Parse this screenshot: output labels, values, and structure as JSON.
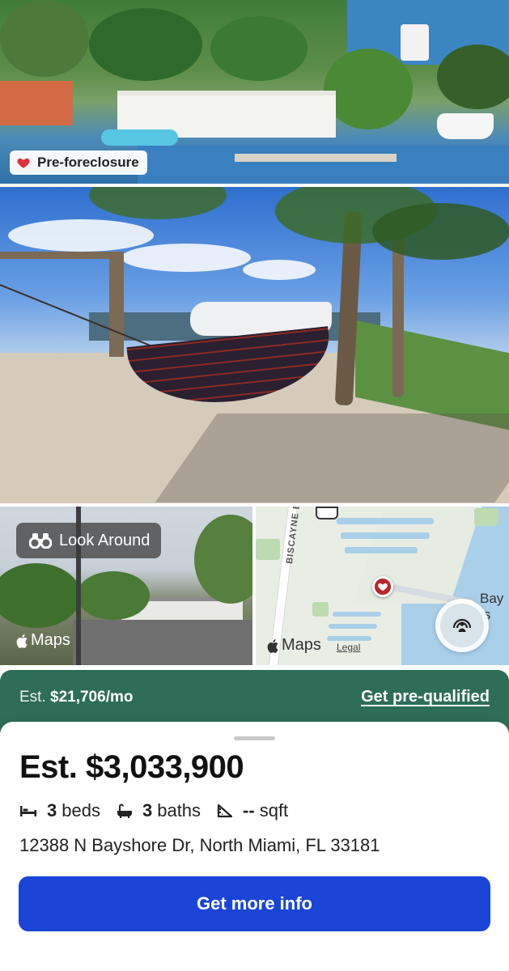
{
  "listing": {
    "status_badge": "Pre-foreclosure",
    "estimated_price": "Est. $3,033,900",
    "beds_count": "3",
    "beds_label": "beds",
    "baths_count": "3",
    "baths_label": "baths",
    "sqft_value": "--",
    "sqft_label": "sqft",
    "address": "12388 N Bayshore Dr, North Miami, FL 33181"
  },
  "photos": {
    "look_around_label": "Look Around",
    "maps_brand": "Maps"
  },
  "map": {
    "road_label": "BISCAYNE BLVD",
    "place_label_line1": "Bay",
    "place_label_line2": "Is",
    "maps_brand": "Maps",
    "legal_link": "Legal"
  },
  "payment": {
    "prefix": "Est.",
    "amount": "$21,706/mo",
    "prequal_link": "Get pre-qualified"
  },
  "actions": {
    "primary_cta": "Get more info"
  },
  "colors": {
    "payment_bar": "#2e6d58",
    "primary_button": "#1a45d6",
    "badge_heart": "#e0303a",
    "map_pin": "#b8262d"
  },
  "icons": {
    "badge": "heart-icon",
    "look_around": "binoculars-icon",
    "beds": "bed-icon",
    "baths": "bathtub-icon",
    "sqft": "ruler-triangle-icon",
    "map_pin": "heart-pin-icon",
    "look_around_map": "look-around-person-icon"
  }
}
